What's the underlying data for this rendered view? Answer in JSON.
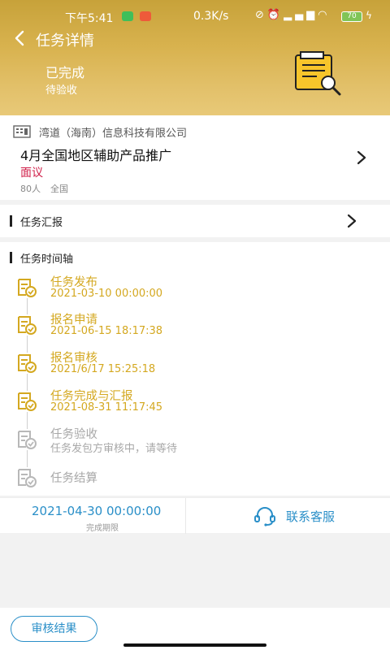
{
  "status_bar": {
    "time": "下午5:41",
    "network_speed": "0.3K/s",
    "battery": "70",
    "badge_colors": [
      "#3fbf5a",
      "#ee5a3a"
    ]
  },
  "header": {
    "title": "任务详情",
    "status": "已完成",
    "substatus": "待验收"
  },
  "task": {
    "company": "湾道（海南）信息科技有限公司",
    "title": "4月全国地区辅助产品推广",
    "price": "面议",
    "people": "80人",
    "region": "全国"
  },
  "report": {
    "title": "任务汇报"
  },
  "timeline": {
    "title": "任务时间轴",
    "items": [
      {
        "title": "任务发布",
        "time": "2021-03-10 00:00:00",
        "state": "done"
      },
      {
        "title": "报名申请",
        "time": "2021-06-15 18:17:38",
        "state": "done"
      },
      {
        "title": "报名审核",
        "time": "2021/6/17 15:25:18",
        "state": "done"
      },
      {
        "title": "任务完成与汇报",
        "time": "2021-08-31 11:17:45",
        "state": "done"
      },
      {
        "title": "任务验收",
        "time": "任务发包方审核中，请等待",
        "state": "pending"
      },
      {
        "title": "任务结算",
        "time": "",
        "state": "pending"
      }
    ]
  },
  "footer": {
    "deadline": "2021-04-30 00:00:00",
    "deadline_label": "完成期限",
    "support": "联系客服"
  },
  "actions": {
    "result_button": "审核结果"
  },
  "colors": {
    "accent": "#d4a820",
    "link": "#2a8fc8",
    "price": "#d0204a",
    "pending": "#a8a8a8"
  }
}
